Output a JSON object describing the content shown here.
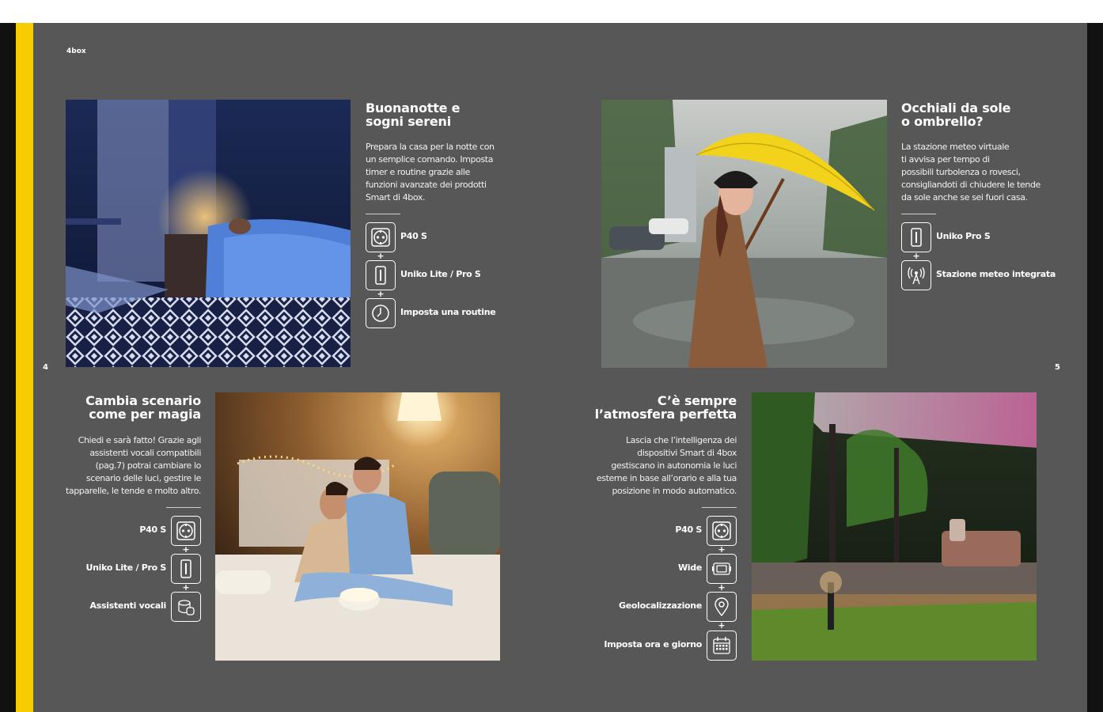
{
  "brand": "4box",
  "page_numbers": {
    "left": "4",
    "right": "5"
  },
  "sections": {
    "goodnight": {
      "title_lines": [
        "Buonanotte e",
        "sogni sereni"
      ],
      "body_lines": [
        "Prepara la casa per la notte con",
        "un semplice comando. Imposta",
        "timer e routine grazie alle",
        "funzioni avanzate dei prodotti",
        "Smart di 4box."
      ],
      "features": [
        {
          "label": "P40 S",
          "icon": "socket-icon"
        },
        {
          "label": "Uniko Lite / Pro S",
          "icon": "switch-icon"
        },
        {
          "label": "Imposta una routine",
          "icon": "clock-icon"
        }
      ]
    },
    "weather": {
      "title_lines": [
        "Occhiali da sole",
        "o ombrello?"
      ],
      "body_lines": [
        "La stazione meteo virtuale",
        "ti avvisa per tempo di",
        "possibili turbolenza o rovesci,",
        "consigliandoti di chiudere le tende",
        "da sole anche se sei fuori casa."
      ],
      "features": [
        {
          "label": "Uniko Pro S",
          "icon": "switch-icon"
        },
        {
          "label": "Stazione meteo integrata",
          "icon": "antenna-icon"
        }
      ]
    },
    "scenario": {
      "title_lines": [
        "Cambia scenario",
        "come per magia"
      ],
      "body_lines": [
        "Chiedi e sarà fatto! Grazie agli",
        "assistenti vocali compatibili",
        "(pag.7) potrai cambiare lo",
        "scenario delle luci, gestire le",
        "tapparelle, le tende e molto altro."
      ],
      "features": [
        {
          "label": "P40 S",
          "icon": "socket-icon"
        },
        {
          "label": "Uniko Lite / Pro S",
          "icon": "switch-icon"
        },
        {
          "label": "Assistenti vocali",
          "icon": "smart-speaker-icon"
        }
      ]
    },
    "atmosphere": {
      "title_lines": [
        "C’è sempre",
        "l’atmosfera perfetta"
      ],
      "body_lines": [
        "Lascia che l’intelligenza dei",
        "dispositivi Smart di 4box",
        "gestiscano in autonomia le luci",
        "esterne in base all’orario e alla tua",
        "posizione in modo automatico."
      ],
      "features": [
        {
          "label": "P40 S",
          "icon": "socket-icon"
        },
        {
          "label": "Wide",
          "icon": "wide-module-icon"
        },
        {
          "label": "Geolocalizzazione",
          "icon": "location-pin-icon"
        },
        {
          "label": "Imposta ora e giorno",
          "icon": "calendar-icon"
        }
      ]
    }
  },
  "plus_sign": "+",
  "colors": {
    "accent": "#f5cd00",
    "page_bg": "#575757",
    "text": "#ffffff"
  }
}
